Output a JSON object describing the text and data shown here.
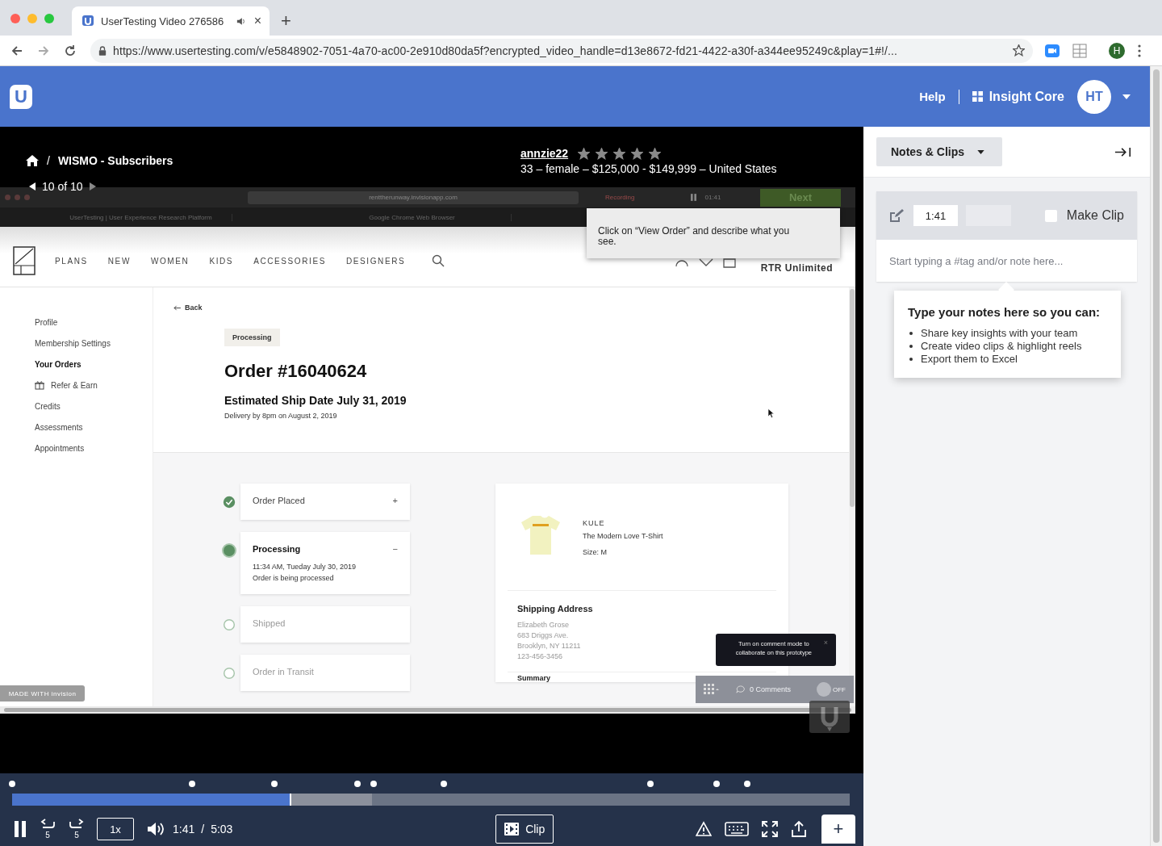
{
  "browser": {
    "tab_title": "UserTesting Video 276586",
    "tab_close": "×",
    "new_tab": "+",
    "url": "https://www.usertesting.com/v/e5848902-7051-4a70-ac00-2e910d80da5f?encrypted_video_handle=d13e8672-fd21-4422-a30f-a344ee95249c&play=1#!/...",
    "profile": "H"
  },
  "header": {
    "logo": "U",
    "help": "Help",
    "workspace": "Insight Core",
    "avatar": "HT"
  },
  "video": {
    "breadcrumb": "WISMO - Subscribers",
    "separator": "/",
    "counter": "10 of 10",
    "tester": "annzie22",
    "stars": 5,
    "demographics": "33 – female – $125,000 - $149,999 – United States"
  },
  "recording": {
    "url": "renttherunway.invisionapp.com",
    "status": "Recording",
    "timer": "01:41",
    "next": "Next",
    "tabs": [
      "UserTesting | User Experience Research Platform",
      "Google Chrome Web Browser"
    ],
    "task": "Click on “View Order” and describe what you see."
  },
  "site": {
    "nav": [
      "PLANS",
      "NEW",
      "WOMEN",
      "KIDS",
      "ACCESSORIES",
      "DESIGNERS"
    ],
    "account": "RTR Unlimited",
    "sidebar": [
      {
        "label": "Profile",
        "selected": false,
        "kind": "plain"
      },
      {
        "label": "Membership Settings",
        "selected": false,
        "kind": "plain"
      },
      {
        "label": "Your Orders",
        "selected": true,
        "kind": "plain"
      },
      {
        "label": "Refer & Earn",
        "selected": false,
        "kind": "gift"
      },
      {
        "label": "Credits",
        "selected": false,
        "kind": "plain"
      },
      {
        "label": "Assessments",
        "selected": false,
        "kind": "plain"
      },
      {
        "label": "Appointments",
        "selected": false,
        "kind": "plain"
      }
    ],
    "back": "Back",
    "status": "Processing",
    "order": "Order #16040624",
    "ship_date": "Estimated Ship Date July 31, 2019",
    "delivery": "Delivery by 8pm on August 2, 2019",
    "steps": [
      {
        "title": "Order Placed",
        "kind": "done",
        "toggle": "+"
      },
      {
        "title": "Processing",
        "kind": "current",
        "toggle": "−",
        "details": [
          "11:34 AM, Tueday July 30, 2019",
          "Order is being processed"
        ]
      },
      {
        "title": "Shipped",
        "kind": "pending"
      },
      {
        "title": "Order in Transit",
        "kind": "pending"
      }
    ],
    "item": {
      "brand": "KULE",
      "name": "The Modern Love T-Shirt",
      "size": "Size: M"
    },
    "address": {
      "heading": "Shipping Address",
      "lines": [
        "Elizabeth Grose",
        "683 Driggs Ave.",
        "Brooklyn, NY 11211",
        "123-456-3456"
      ]
    },
    "summary": "Summary",
    "badge": "MADE WITH invision",
    "comment_tip": "Turn on comment mode to collaborate on this prototype",
    "comment_tip_close": "×",
    "comments": "0 Comments",
    "comment_mode": {
      "on": false,
      "label": "OFF"
    }
  },
  "player": {
    "playing": true,
    "progress": {
      "level": 0.333
    },
    "buffered": {
      "level": 0.43
    },
    "skip_back": "5",
    "skip_forward": "5",
    "speed": "1x",
    "time": "1:41",
    "separator": "/",
    "duration": "5:03",
    "clip": "Clip",
    "add": "+"
  },
  "notes": {
    "mode": "Notes & Clips",
    "timestamp": "1:41",
    "make_clip": {
      "label": "Make Clip",
      "checked": false
    },
    "placeholder": "Start typing a #tag and/or note here...",
    "tip_heading": "Type your notes here so you can:",
    "tip_items": [
      "Share key insights with your team",
      "Create video clips & highlight reels",
      "Export them to Excel"
    ]
  }
}
